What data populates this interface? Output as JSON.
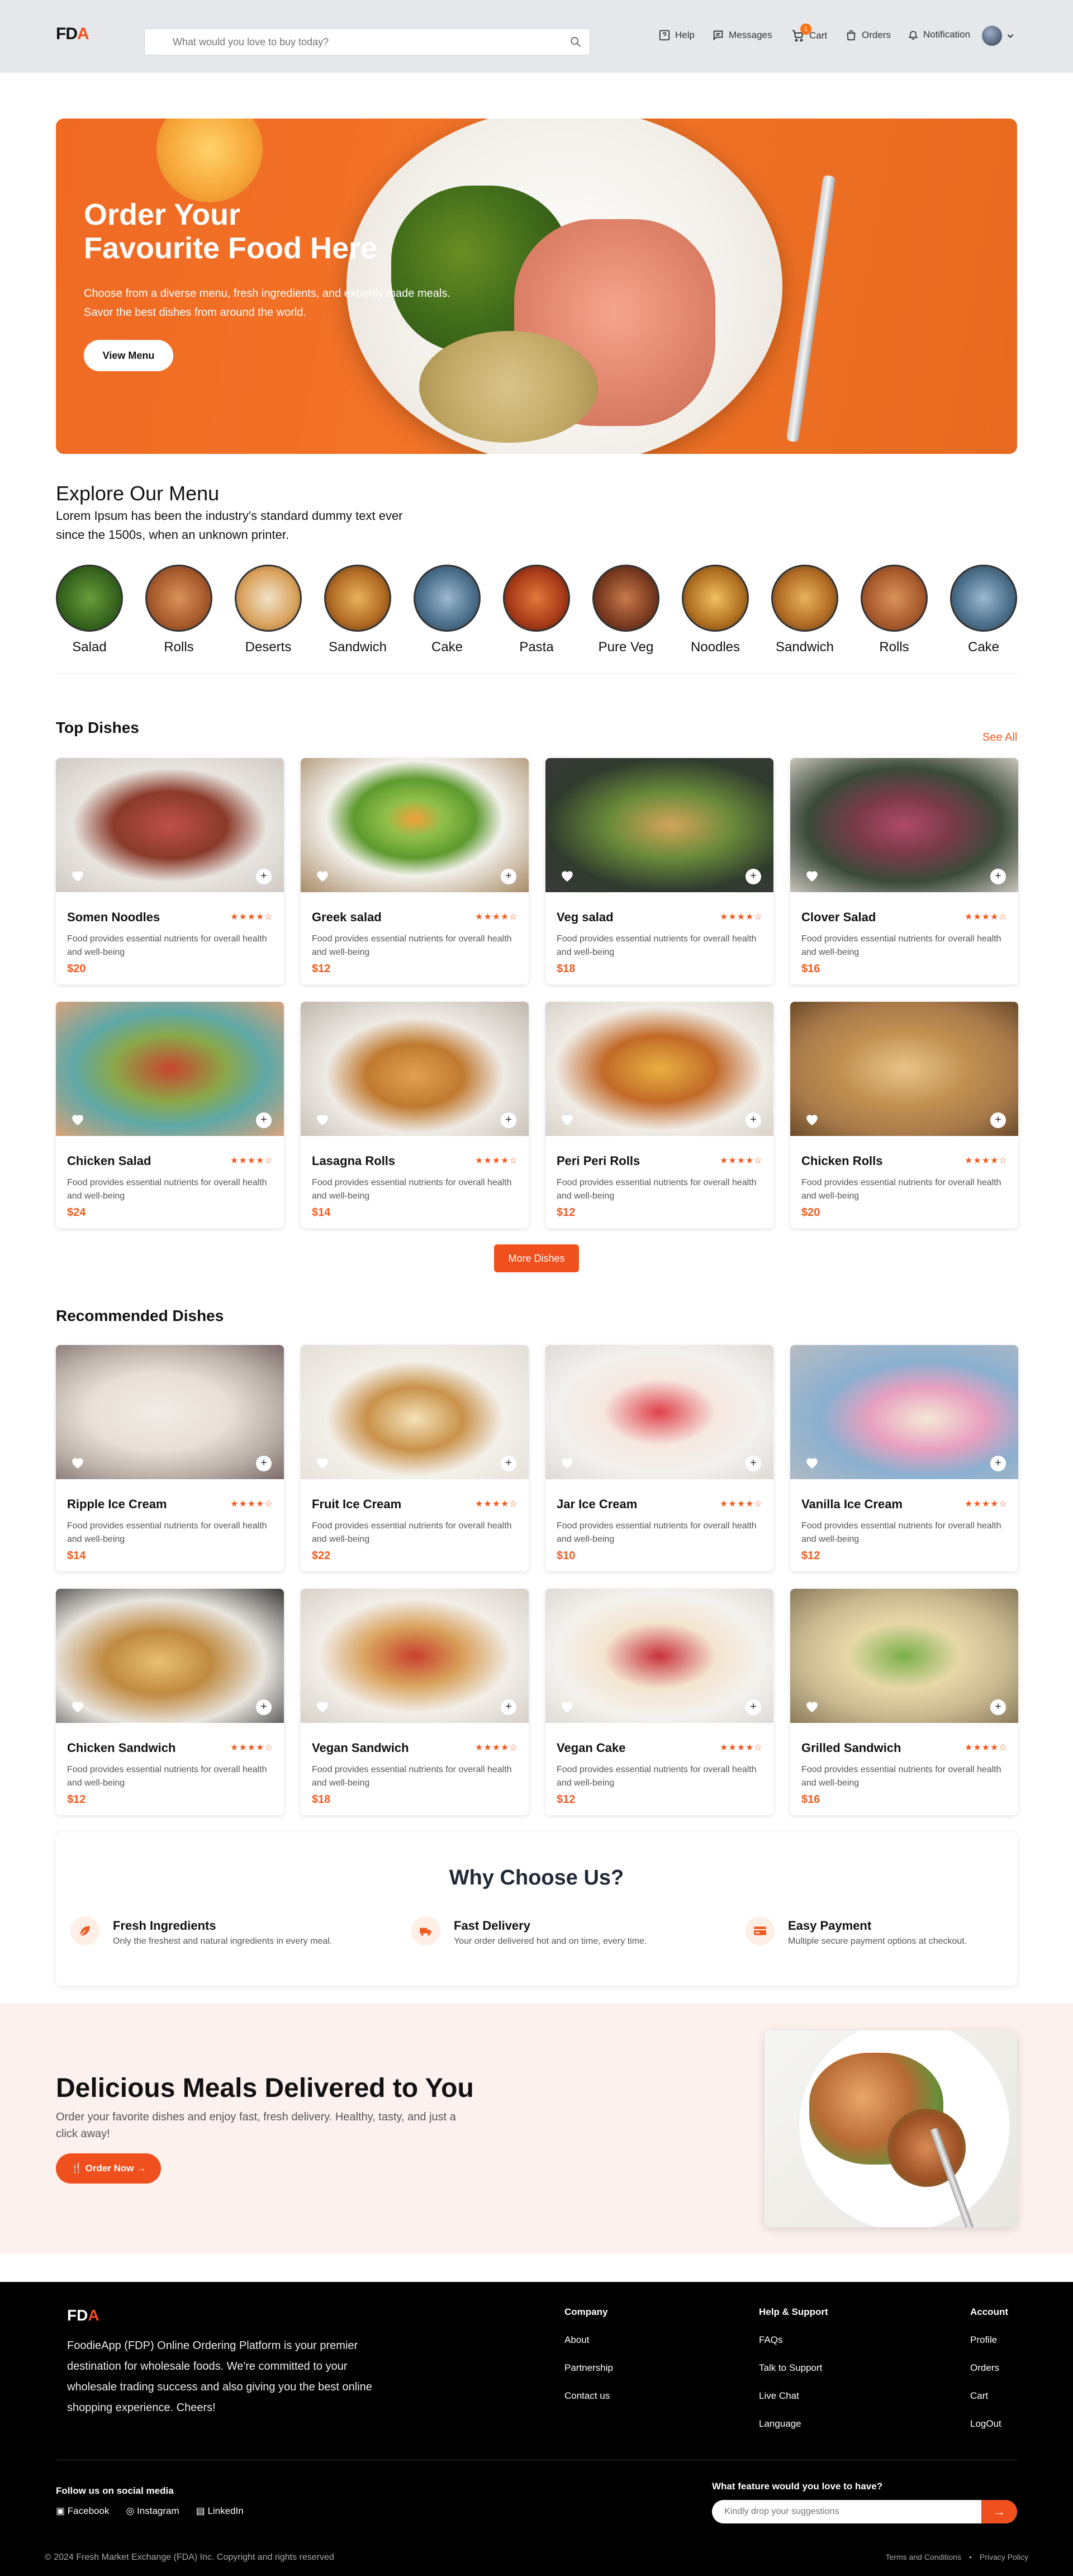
{
  "header": {
    "logo_main": "FD",
    "logo_accent": "A",
    "search_placeholder": "What would you love to buy today?",
    "nav": {
      "help": "Help",
      "messages": "Messages",
      "cart": "Cart",
      "cart_count": "1",
      "orders": "Orders",
      "notification": "Notification"
    }
  },
  "hero": {
    "title_line1": "Order Your",
    "title_line2": "Favourite Food Here",
    "subtitle_line1": "Choose from a diverse menu, fresh ingredients, and expertly made meals.",
    "subtitle_line2": "Savor the best dishes from around the world.",
    "button": "View Menu"
  },
  "explore": {
    "title": "Explore Our Menu",
    "description": "Lorem Ipsum has been the industry's standard dummy text ever since the 1500s, when an unknown printer.",
    "categories": [
      "Salad",
      "Rolls",
      "Deserts",
      "Sandwich",
      "Cake",
      "Pasta",
      "Pure Veg",
      "Noodles",
      "Sandwich",
      "Rolls",
      "Cake"
    ]
  },
  "top_dishes": {
    "title": "Top Dishes",
    "see_all": "See All",
    "items": [
      {
        "name": "Somen Noodles",
        "rating": "★★★★☆",
        "desc": "Food provides essential nutrients for overall health and well-being",
        "price": "$20"
      },
      {
        "name": "Greek salad",
        "rating": "★★★★☆",
        "desc": "Food provides essential nutrients for overall health and well-being",
        "price": "$12"
      },
      {
        "name": "Veg salad",
        "rating": "★★★★☆",
        "desc": "Food provides essential nutrients for overall health and well-being",
        "price": "$18"
      },
      {
        "name": "Clover Salad",
        "rating": "★★★★☆",
        "desc": "Food provides essential nutrients for overall health and well-being",
        "price": "$16"
      },
      {
        "name": "Chicken Salad",
        "rating": "★★★★☆",
        "desc": "Food provides essential nutrients for overall health and well-being",
        "price": "$24"
      },
      {
        "name": "Lasagna Rolls",
        "rating": "★★★★☆",
        "desc": "Food provides essential nutrients for overall health and well-being",
        "price": "$14"
      },
      {
        "name": "Peri Peri Rolls",
        "rating": "★★★★☆",
        "desc": "Food provides essential nutrients for overall health and well-being",
        "price": "$12"
      },
      {
        "name": "Chicken Rolls",
        "rating": "★★★★☆",
        "desc": "Food provides essential nutrients for overall health and well-being",
        "price": "$20"
      }
    ],
    "more_button": "More Dishes"
  },
  "recommended": {
    "title": "Recommended Dishes",
    "items": [
      {
        "name": "Ripple Ice Cream",
        "rating": "★★★★☆",
        "desc": "Food provides essential nutrients for overall health and well-being",
        "price": "$14"
      },
      {
        "name": "Fruit Ice Cream",
        "rating": "★★★★☆",
        "desc": "Food provides essential nutrients for overall health and well-being",
        "price": "$22"
      },
      {
        "name": "Jar Ice Cream",
        "rating": "★★★★☆",
        "desc": "Food provides essential nutrients for overall health and well-being",
        "price": "$10"
      },
      {
        "name": "Vanilla Ice Cream",
        "rating": "★★★★☆",
        "desc": "Food provides essential nutrients for overall health and well-being",
        "price": "$12"
      },
      {
        "name": "Chicken Sandwich",
        "rating": "★★★★☆",
        "desc": "Food provides essential nutrients for overall health and well-being",
        "price": "$12"
      },
      {
        "name": "Vegan Sandwich",
        "rating": "★★★★☆",
        "desc": "Food provides essential nutrients for overall health and well-being",
        "price": "$18"
      },
      {
        "name": "Vegan Cake",
        "rating": "★★★★☆",
        "desc": "Food provides essential nutrients for overall health and well-being",
        "price": "$12"
      },
      {
        "name": "Grilled Sandwich",
        "rating": "★★★★☆",
        "desc": "Food provides essential nutrients for overall health and well-being",
        "price": "$16"
      }
    ]
  },
  "why": {
    "title": "Why Choose Us?",
    "features": [
      {
        "title": "Fresh Ingredients",
        "desc": "Only the freshest and natural ingredients in every meal.",
        "icon": "leaf-icon"
      },
      {
        "title": "Fast Delivery",
        "desc": "Your order delivered hot and on time, every time.",
        "icon": "truck-icon"
      },
      {
        "title": "Easy Payment",
        "desc": "Multiple secure payment options at checkout.",
        "icon": "card-icon"
      }
    ]
  },
  "delivered": {
    "title": "Delicious Meals Delivered to You",
    "desc": "Order your favorite dishes and enjoy fast, fresh delivery. Healthy, tasty, and just a click away!",
    "button": "Order Now"
  },
  "footer": {
    "logo_main": "FD",
    "logo_accent": "A",
    "about": "FoodieApp (FDP) Online Ordering Platform is your premier destination for wholesale foods. We're committed to your wholesale trading success and also giving you the best online shopping experience. Cheers!",
    "company": {
      "heading": "Company",
      "links": [
        "About",
        "Partnership",
        "Contact us"
      ]
    },
    "help": {
      "heading": "Help & Support",
      "links": [
        "FAQs",
        "Talk to Support",
        "Live Chat",
        "Language"
      ]
    },
    "account": {
      "heading": "Account",
      "links": [
        "Profile",
        "Orders",
        "Cart",
        "LogOut"
      ]
    },
    "follow": "Follow us on social media",
    "social": {
      "facebook": "Facebook",
      "instagram": "Instagram",
      "linkedin": "LinkedIn"
    },
    "feature_question": "What feature would you love to have?",
    "suggestion_placeholder": "Kindly drop your suggestions",
    "copyright": "© 2024 Fresh Market Exchange (FDA) Inc. Copyright and rights reserved",
    "terms": "Terms and Conditions",
    "separator": "•",
    "privacy": "Privacy Policy"
  },
  "colors": {
    "accent": "#f0501e",
    "header_bg": "#e5e7eb",
    "footer_bg": "#000000"
  }
}
